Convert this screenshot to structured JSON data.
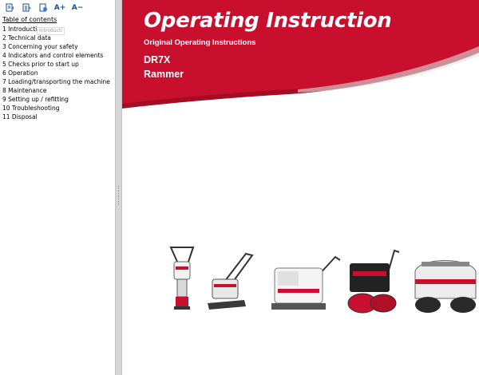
{
  "toolbar": {
    "buttons": [
      {
        "icon": "collapse-all-icon"
      },
      {
        "icon": "expand-all-icon"
      },
      {
        "icon": "sync-toc-icon"
      },
      {
        "icon": "font-increase-icon",
        "label": "A+"
      },
      {
        "icon": "font-decrease-icon",
        "label": "A−"
      }
    ]
  },
  "toc": {
    "title": "Table of contents",
    "items": [
      {
        "label": "1 Introduction"
      },
      {
        "label": "2 Technical data"
      },
      {
        "label": "3 Concerning your safety"
      },
      {
        "label": "4 Indicators and control elements"
      },
      {
        "label": "5 Checks prior to start up"
      },
      {
        "label": "6 Operation"
      },
      {
        "label": "7 Loading/transporting the machine"
      },
      {
        "label": "8 Maintenance"
      },
      {
        "label": "9 Setting up / refitting"
      },
      {
        "label": "10 Troubleshooting"
      },
      {
        "label": "11 Disposal"
      }
    ],
    "tooltip": "Introducti"
  },
  "document": {
    "title": "Operating Instruction",
    "subtitle": "Original Operating Instructions",
    "model": "DR7X",
    "type": "Rammer"
  },
  "colors": {
    "brand_red": "#c8102e",
    "brand_red_dark": "#a50d24",
    "toolbar_icon": "#1d4f91",
    "splitter": "#d6d6d6"
  },
  "images": {
    "machines": [
      "rammer",
      "vibratory-plate",
      "reversible-plate",
      "walk-behind-roller",
      "trench-roller"
    ]
  }
}
